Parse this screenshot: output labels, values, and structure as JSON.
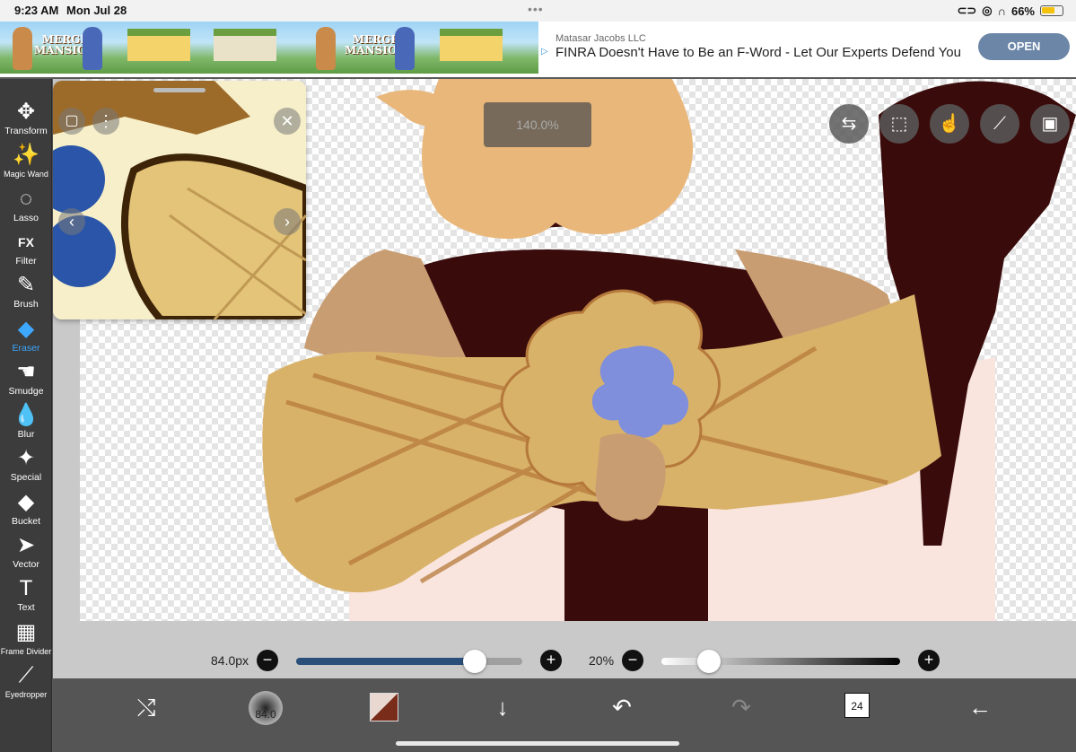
{
  "status": {
    "time": "9:23 AM",
    "date": "Mon Jul 28",
    "battery": "66%",
    "battery_level": 0.66
  },
  "ad": {
    "logo_left": "MERGE\nMANSION",
    "logo_right": "MERGE\nMANSION",
    "advertiser": "Matasar Jacobs LLC",
    "headline": "FINRA Doesn't Have to Be an F-Word - Let Our Experts Defend You",
    "open_label": "OPEN"
  },
  "toolbar": {
    "tools": [
      {
        "label": "Transform",
        "icon": "transform-icon",
        "glyph": "✥"
      },
      {
        "label": "Magic Wand",
        "icon": "magic-wand-icon",
        "glyph": "✨"
      },
      {
        "label": "Lasso",
        "icon": "lasso-icon",
        "glyph": "◌"
      },
      {
        "label": "Filter",
        "icon": "filter-icon",
        "glyph": "FX"
      },
      {
        "label": "Brush",
        "icon": "brush-icon",
        "glyph": "✎"
      },
      {
        "label": "Eraser",
        "icon": "eraser-icon",
        "glyph": "◆",
        "active": true
      },
      {
        "label": "Smudge",
        "icon": "smudge-icon",
        "glyph": "☚"
      },
      {
        "label": "Blur",
        "icon": "blur-icon",
        "glyph": "💧"
      },
      {
        "label": "Special",
        "icon": "special-icon",
        "glyph": "✦"
      },
      {
        "label": "Bucket",
        "icon": "bucket-icon",
        "glyph": "◆"
      },
      {
        "label": "Vector",
        "icon": "vector-icon",
        "glyph": "➤"
      },
      {
        "label": "Text",
        "icon": "text-icon",
        "glyph": "T"
      },
      {
        "label": "Frame Divider",
        "icon": "frame-divider-icon",
        "glyph": "▦"
      },
      {
        "label": "Eyedropper",
        "icon": "eyedropper-icon",
        "glyph": "⟋"
      }
    ]
  },
  "canvas": {
    "zoom_label": "140.0%"
  },
  "sliders": {
    "brush_size_label": "84.0px",
    "brush_size_fraction": 0.79,
    "opacity_label": "20%",
    "opacity_fraction": 0.2
  },
  "bottombar": {
    "brush_preview_label": "84.0",
    "layers_count": "24"
  },
  "colors": {
    "accent": "#3ea8ff",
    "primary_color": "#7a2c1a",
    "size_track": "#2a4f7a"
  }
}
